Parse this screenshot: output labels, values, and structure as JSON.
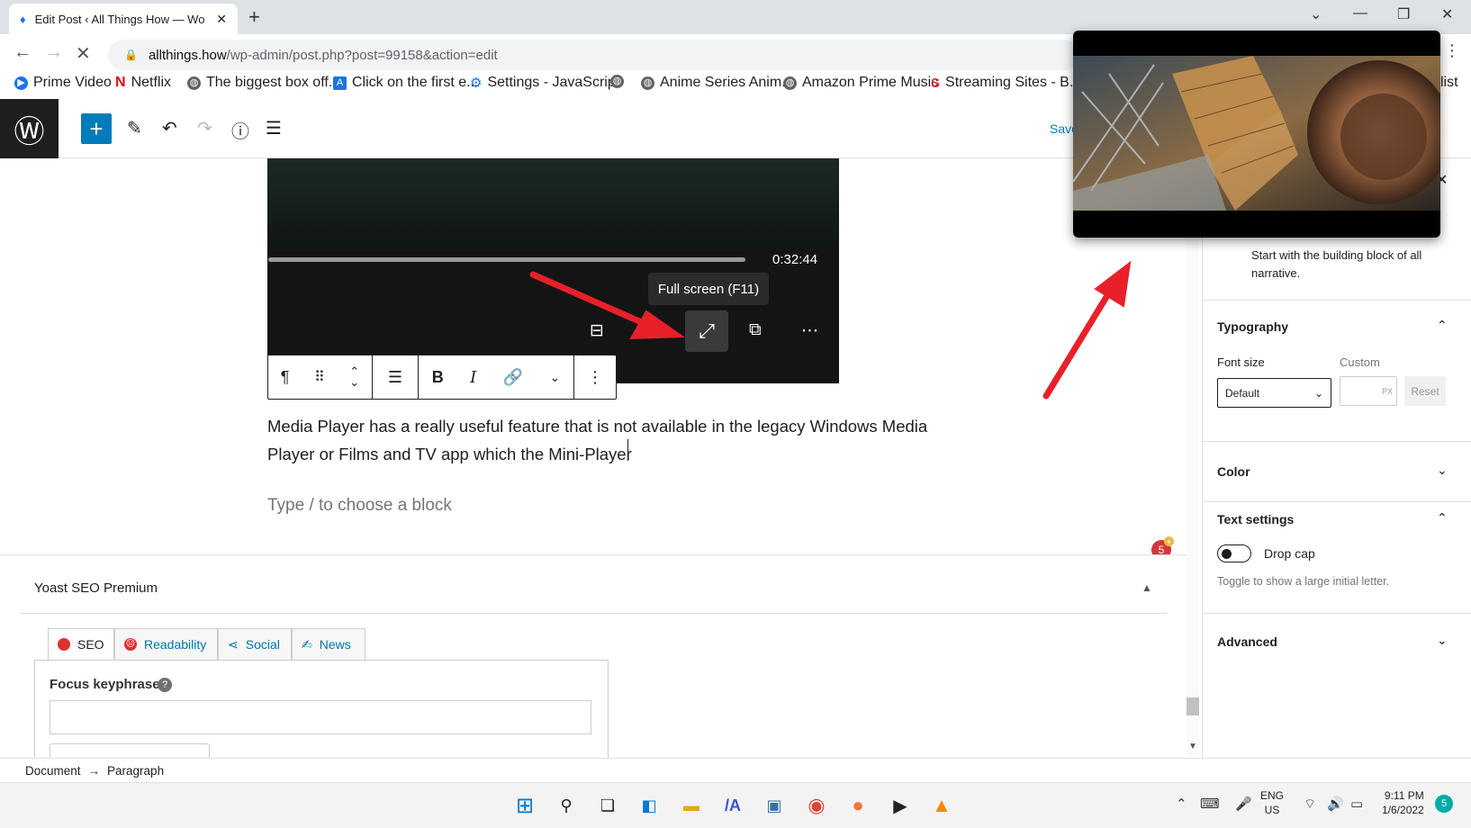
{
  "browser": {
    "tab_title": "Edit Post ‹ All Things How — Wo",
    "new_tab": "+",
    "url_host": "allthings.how",
    "url_path": "/wp-admin/post.php?post=99158&action=edit",
    "bookmarks": [
      {
        "label": "Prime Video",
        "icon": "play-circle-icon",
        "color": "#1a73e8"
      },
      {
        "label": "Netflix",
        "icon": "netflix-icon",
        "color": "#e50914"
      },
      {
        "label": "The biggest box off...",
        "icon": "globe-icon",
        "color": "#5f6368"
      },
      {
        "label": "Click on the first e...",
        "icon": "a-icon",
        "color": "#1a73e8"
      },
      {
        "label": "Settings - JavaScript",
        "icon": "gear-icon",
        "color": "#1a73e8"
      },
      {
        "label": "",
        "icon": "globe-icon",
        "color": "#5f6368"
      },
      {
        "label": "Anime Series Anim...",
        "icon": "globe-icon",
        "color": "#5f6368"
      },
      {
        "label": "Amazon Prime Music",
        "icon": "globe-icon",
        "color": "#5f6368"
      },
      {
        "label": "Streaming Sites - B...",
        "icon": "s-icon",
        "color": "#e53935"
      },
      {
        "label": "list",
        "icon": "",
        "color": "#333"
      }
    ]
  },
  "wp": {
    "save_draft": "Save",
    "video_time": "0:32:44",
    "tooltip": "Full screen (F11)",
    "paragraph": "Media Player has a really useful feature that is not available in the legacy Windows Media Player or Films and TV app which the Mini-Player",
    "placeholder": "Type / to choose a block",
    "notif_count": "5",
    "notif_plus": "+"
  },
  "yoast": {
    "title": "Yoast SEO Premium",
    "tabs": [
      "SEO",
      "Readability",
      "Social",
      "News"
    ],
    "focus_label": "Focus keyphrase",
    "help": "?"
  },
  "sidebar": {
    "description": "Start with the building block of all narrative.",
    "typography": "Typography",
    "font_size": "Font size",
    "custom": "Custom",
    "font_size_value": "Default",
    "px": "PX",
    "reset": "Reset",
    "color": "Color",
    "text_settings": "Text settings",
    "drop_cap": "Drop cap",
    "drop_cap_help": "Toggle to show a large initial letter.",
    "advanced": "Advanced"
  },
  "breadcrumbs": {
    "root": "Document",
    "arrow": "→",
    "leaf": "Paragraph"
  },
  "taskbar": {
    "lang": "ENG",
    "region": "US",
    "time": "9:11 PM",
    "date": "1/6/2022",
    "notifications": "5"
  },
  "colors": {
    "wp_blue": "#007cba",
    "arrow_red": "#e8202a",
    "wp_dark": "#1e1e1e"
  }
}
